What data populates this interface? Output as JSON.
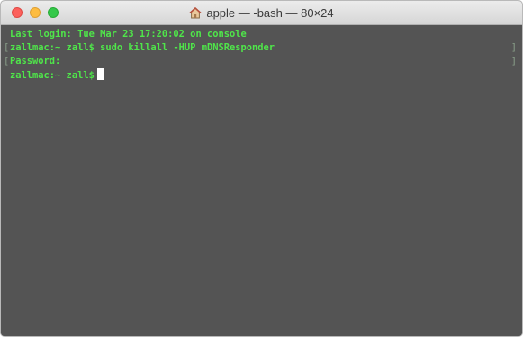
{
  "window": {
    "title": "apple — -bash — 80×24",
    "title_icon": "home-icon"
  },
  "terminal": {
    "lines": [
      "Last login: Tue Mar 23 17:20:02 on console",
      "zallmac:~ zall$ sudo killall -HUP mDNSResponder",
      "Password:",
      "zallmac:~ zall$"
    ],
    "text_color": "#4fe64a",
    "background_color": "#545454"
  },
  "colors": {
    "close": "#fc605c",
    "minimize": "#fdbc40",
    "maximize": "#34c84a"
  }
}
